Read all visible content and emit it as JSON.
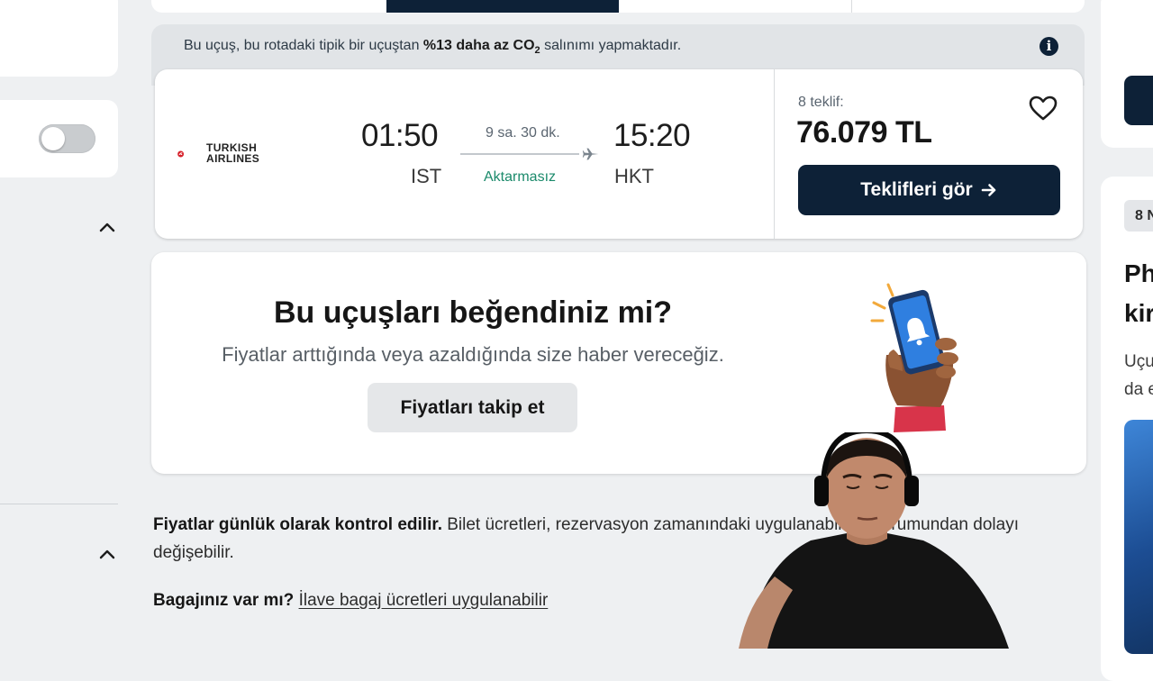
{
  "flight": {
    "co2_prefix": "Bu uçuş, bu rotadaki tipik bir uçuştan ",
    "co2_highlight": "%13 daha az CO",
    "co2_sub": "2",
    "co2_suffix": " salınımı yapmaktadır.",
    "airline_line1": "TURKISH",
    "airline_line2": "AIRLINES",
    "departure_time": "01:50",
    "departure_airport": "IST",
    "duration": "9 sa. 30 dk.",
    "stops": "Aktarmasız",
    "arrival_time": "15:20",
    "arrival_airport": "HKT",
    "offer_count": "8 teklif:",
    "price": "76.079 TL",
    "deals_button": "Teklifleri gör"
  },
  "price_alert": {
    "title": "Bu uçuşları beğendiniz mi?",
    "subtitle": "Fiyatlar arttığında veya azaldığında size haber vereceğiz.",
    "button": "Fiyatları takip et"
  },
  "footer": {
    "note_bold": "Fiyatlar günlük olarak kontrol edilir.",
    "note_text": " Bilet ücretleri, rezervasyon zamanındaki uygulanabilirlik durumundan dolayı değişebilir.",
    "baggage_bold": "Bagajınız var mı?",
    "baggage_link": "İlave bagaj ücretleri uygulanabilir"
  },
  "right_panel": {
    "badge": "8 N",
    "title_line1": "Ph",
    "title_line2": "kir",
    "desc_line1": "Uçu",
    "desc_line2": "da e"
  },
  "colors": {
    "navy": "#0d2137",
    "stops_green": "#1b8a6b",
    "page_bg": "#eef0f2"
  },
  "icons": [
    "info-icon",
    "plane-icon",
    "heart-icon",
    "arrow-right-icon",
    "chevron-up-icon",
    "airline-logo",
    "phone-bell-illustration"
  ]
}
